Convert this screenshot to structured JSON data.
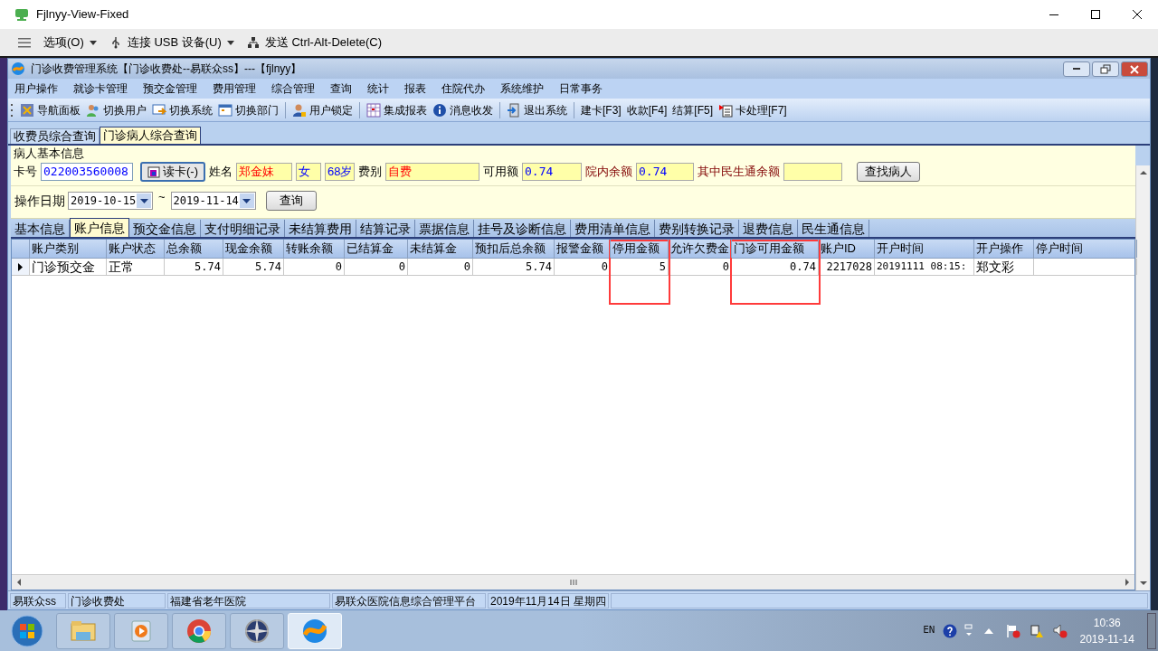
{
  "outer_window": {
    "title": "Fjlnyy-View-Fixed",
    "menu": [
      {
        "label": "选项(O)",
        "kind": "dropdown"
      },
      {
        "label": "连接 USB 设备(U)",
        "kind": "dropdown"
      },
      {
        "label": "发送 Ctrl-Alt-Delete(C)",
        "kind": "plain"
      }
    ]
  },
  "app": {
    "title": "门诊收费管理系统【门诊收费处--易联众ss】---【fjlnyy】",
    "menu": [
      "用户操作",
      "就诊卡管理",
      "预交金管理",
      "费用管理",
      "综合管理",
      "查询",
      "统计",
      "报表",
      "住院代办",
      "系统维护",
      "日常事务"
    ],
    "toolbar": [
      [
        {
          "label": "导航面板",
          "kind": "icon"
        },
        {
          "label": "切换用户",
          "kind": "icon"
        },
        {
          "label": "切换系统",
          "kind": "icon"
        },
        {
          "label": "切换部门",
          "kind": "icon"
        }
      ],
      [
        {
          "label": "用户锁定",
          "kind": "icon"
        }
      ],
      [
        {
          "label": "集成报表",
          "kind": "icon"
        },
        {
          "label": "消息收发",
          "kind": "icon"
        }
      ],
      [
        {
          "label": "退出系统",
          "kind": "icon"
        }
      ],
      [
        {
          "label": "建卡[F3]",
          "kind": "text"
        },
        {
          "label": "收款[F4]",
          "kind": "text"
        },
        {
          "label": "结算[F5]",
          "kind": "text"
        },
        {
          "label": "卡处理[F7]",
          "kind": "icon"
        }
      ]
    ],
    "tabs": [
      {
        "label": "收费员综合查询",
        "selected": false
      },
      {
        "label": "门诊病人综合查询",
        "selected": true
      }
    ],
    "patient": {
      "group_title": "病人基本信息",
      "card_label": "卡号",
      "card_no": "022003560008",
      "read_card_button": "读卡(-)",
      "name_label": "姓名",
      "name": "郑金妹",
      "sex": "女",
      "age": "68岁",
      "fee_type_label": "费别",
      "fee_type": "自费",
      "available_label": "可用额",
      "available": "0.74",
      "hospital_balance_label": "院内余额",
      "hospital_balance": "0.74",
      "minshengtong_label": "其中民生通余额",
      "find_button": "查找病人",
      "date_label": "操作日期",
      "date_from": "2019-10-15",
      "date_separator": "~",
      "date_to": "2019-11-14",
      "query_button": "查询"
    },
    "sub_tabs": [
      {
        "label": "基本信息",
        "selected": false
      },
      {
        "label": "账户信息",
        "selected": true
      },
      {
        "label": "预交金信息",
        "selected": false
      },
      {
        "label": "支付明细记录",
        "selected": false
      },
      {
        "label": "未结算费用",
        "selected": false
      },
      {
        "label": "结算记录",
        "selected": false
      },
      {
        "label": "票据信息",
        "selected": false
      },
      {
        "label": "挂号及诊断信息",
        "selected": false
      },
      {
        "label": "费用清单信息",
        "selected": false
      },
      {
        "label": "费别转换记录",
        "selected": false
      },
      {
        "label": "退费信息",
        "selected": false
      },
      {
        "label": "民生通信息",
        "selected": false
      }
    ],
    "table": {
      "columns": [
        {
          "label": "账户类别",
          "highlighted": false
        },
        {
          "label": "账户状态",
          "highlighted": false
        },
        {
          "label": "总余额",
          "highlighted": false
        },
        {
          "label": "现金余额",
          "highlighted": false
        },
        {
          "label": "转账余额",
          "highlighted": false
        },
        {
          "label": "已结算金",
          "highlighted": false
        },
        {
          "label": "未结算金",
          "highlighted": false
        },
        {
          "label": "预扣后总余额",
          "highlighted": false
        },
        {
          "label": "报警金额",
          "highlighted": false
        },
        {
          "label": "停用金额",
          "highlighted": true
        },
        {
          "label": "允许欠费金",
          "highlighted": false
        },
        {
          "label": "门诊可用金额",
          "highlighted": true
        },
        {
          "label": "账户ID",
          "highlighted": false
        },
        {
          "label": "开户时间",
          "highlighted": false
        },
        {
          "label": "开户操作",
          "highlighted": false
        },
        {
          "label": "停户时间",
          "highlighted": false
        }
      ],
      "rows": [
        {
          "current": true,
          "cells": [
            "门诊预交金",
            "正常",
            "5.74",
            "5.74",
            "0",
            "0",
            "0",
            "5.74",
            "0",
            "5",
            "0",
            "0.74",
            "2217028",
            "20191111 08:15:",
            "郑文彩",
            ""
          ]
        }
      ]
    }
  },
  "status_bar": [
    "易联众ss",
    "门诊收费处",
    "福建省老年医院",
    "易联众医院信息综合管理平台",
    "2019年11月14日 星期四"
  ],
  "taskbar": {
    "apps": [
      {
        "selected": false
      },
      {
        "selected": false
      },
      {
        "selected": false
      },
      {
        "selected": false
      },
      {
        "selected": true
      }
    ],
    "language": "EN",
    "time": "10:36",
    "date": "2019-11-14"
  }
}
